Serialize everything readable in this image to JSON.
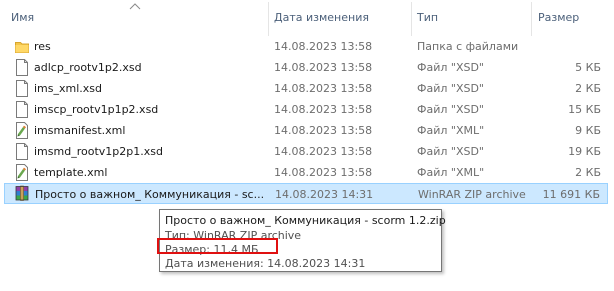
{
  "columns": {
    "name": "Имя",
    "date": "Дата изменения",
    "type": "Тип",
    "size": "Размер"
  },
  "files": [
    {
      "name": "res",
      "date": "14.08.2023 13:58",
      "type": "Папка с файлами",
      "size": "",
      "icon": "folder-icon"
    },
    {
      "name": "adlcp_rootv1p2.xsd",
      "date": "14.08.2023 13:58",
      "type": "Файл \"XSD\"",
      "size": "5 КБ",
      "icon": "file-icon"
    },
    {
      "name": "ims_xml.xsd",
      "date": "14.08.2023 13:58",
      "type": "Файл \"XSD\"",
      "size": "2 КБ",
      "icon": "file-icon"
    },
    {
      "name": "imscp_rootv1p1p2.xsd",
      "date": "14.08.2023 13:58",
      "type": "Файл \"XSD\"",
      "size": "15 КБ",
      "icon": "file-icon"
    },
    {
      "name": "imsmanifest.xml",
      "date": "14.08.2023 13:58",
      "type": "Файл \"XML\"",
      "size": "9 КБ",
      "icon": "xml-file-icon"
    },
    {
      "name": "imsmd_rootv1p2p1.xsd",
      "date": "14.08.2023 13:58",
      "type": "Файл \"XSD\"",
      "size": "19 КБ",
      "icon": "file-icon"
    },
    {
      "name": "template.xml",
      "date": "14.08.2023 13:58",
      "type": "Файл \"XML\"",
      "size": "2 КБ",
      "icon": "xml-file-icon"
    },
    {
      "name": "Просто о важном_ Коммуникация - sc...",
      "date": "14.08.2023 14:31",
      "type": "WinRAR ZIP archive",
      "size": "11 691 КБ",
      "icon": "winrar-archive-icon",
      "selected": true
    }
  ],
  "tooltip": {
    "title": "Просто о важном_ Коммуникация - scorm 1.2.zip",
    "type_line": "Тип: WinRAR ZIP archive",
    "size_line": "Размер: 11,4 МБ",
    "date_line": "Дата изменения: 14.08.2023 14:31"
  },
  "colors": {
    "selection": "#cce8ff",
    "selection_border": "#99d1ff",
    "highlight": "#e01010",
    "folder": "#f4c64a"
  }
}
